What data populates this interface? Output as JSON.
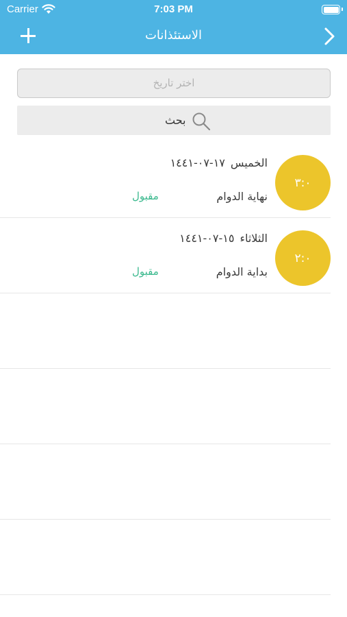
{
  "status_bar": {
    "carrier": "Carrier",
    "time": "7:03 PM"
  },
  "nav": {
    "title": "الاستئذانات",
    "add_icon": "plus-icon",
    "back_icon": "chevron-right-icon"
  },
  "date_picker": {
    "placeholder": "اختر تاريخ"
  },
  "search": {
    "label": "بحث",
    "icon": "search-icon"
  },
  "requests": [
    {
      "duration": "٣:٠",
      "day": "الخميس",
      "date": "١٧-٠٧-١٤٤١",
      "type": "نهاية الدوام",
      "status": "مقبول"
    },
    {
      "duration": "٢:٠",
      "day": "الثلاثاء",
      "date": "١٥-٠٧-١٤٤١",
      "type": "بداية الدوام",
      "status": "مقبول"
    }
  ],
  "colors": {
    "header": "#4db4e3",
    "circle": "#ecc52b",
    "status_accepted": "#3bb98e"
  }
}
